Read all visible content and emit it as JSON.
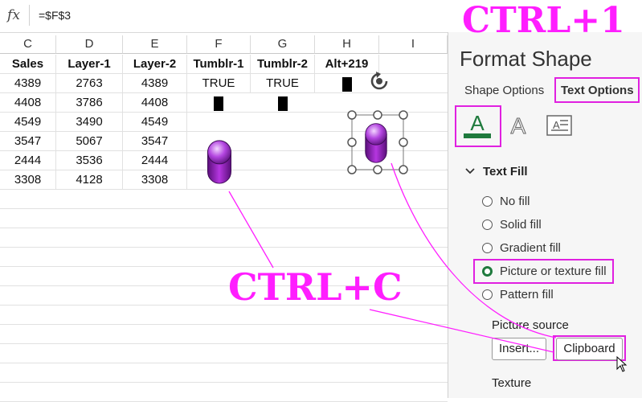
{
  "formula_bar": {
    "fx_label": "fx",
    "formula": "=$F$3"
  },
  "columns": [
    "C",
    "D",
    "E",
    "F",
    "G",
    "H",
    "I"
  ],
  "table": {
    "headers": [
      "Sales",
      "Layer-1",
      "Layer-2",
      "Tumblr-1",
      "Tumblr-2",
      "Alt+219"
    ],
    "rows": [
      [
        "4389",
        "2763",
        "4389",
        "TRUE",
        "TRUE",
        ""
      ],
      [
        "4408",
        "3786",
        "4408",
        "",
        "",
        ""
      ],
      [
        "4549",
        "3490",
        "4549",
        "",
        "",
        ""
      ],
      [
        "3547",
        "5067",
        "3547",
        "",
        "",
        ""
      ],
      [
        "2444",
        "3536",
        "2444",
        "",
        "",
        ""
      ],
      [
        "3308",
        "4128",
        "3308",
        "",
        "",
        ""
      ]
    ]
  },
  "panel": {
    "title": "Format Shape",
    "tabs": [
      "Shape Options",
      "Text Options"
    ],
    "section": "Text Fill",
    "fill_options": [
      "No fill",
      "Solid fill",
      "Gradient fill",
      "Picture or texture fill",
      "Pattern fill"
    ],
    "selected_fill": "Picture or texture fill",
    "picture_source_label": "Picture source",
    "insert_button": "Insert...",
    "clipboard_button": "Clipboard",
    "texture_label": "Texture"
  },
  "annotations": {
    "top": "CTRL+1",
    "middle": "CTRL+C"
  },
  "colors": {
    "annotation": "#ff1eff",
    "accent_green": "#1f7a3d",
    "toggle_purple": "#a020c0"
  },
  "icons": [
    "fx-icon",
    "rotate-handle-icon",
    "text-fill-icon",
    "text-outline-icon",
    "text-box-icon",
    "chevron-down-icon",
    "mouse-cursor-icon"
  ]
}
